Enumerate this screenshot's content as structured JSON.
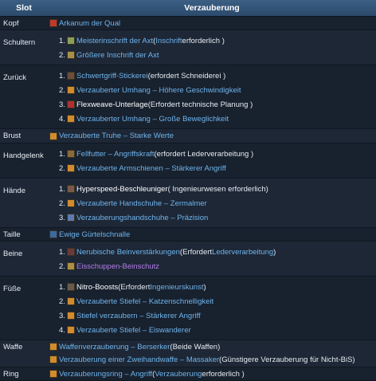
{
  "header": {
    "slot": "Slot",
    "enchant": "Verzauberung"
  },
  "rows": {
    "kopf": {
      "slot": "Kopf",
      "item": "Arkanum der Qual",
      "icon_color": "#c0392b"
    },
    "schultern": {
      "slot": "Schultern",
      "items": [
        {
          "num": "1.",
          "link": "Meisterinschrift der Axt",
          "pre": " (",
          "link2": "Inschrift",
          "post": " erforderlich )",
          "icon_color": "#8aa05a"
        },
        {
          "num": "2.",
          "link": "Größere Inschrift der Axt",
          "icon_color": "#a88f4a"
        }
      ]
    },
    "zurueck": {
      "slot": "Zurück",
      "items": [
        {
          "num": "1.",
          "link": "Schwertgriff-Stickerei",
          "post": " (erfordert Schneiderei )",
          "icon_color": "#6b4f3a"
        },
        {
          "num": "2.",
          "link": "Verzauberter Umhang – Höhere Geschwindigkeit",
          "icon_color": "#d28b2d"
        },
        {
          "num": "3.",
          "link": "Flexweave-Unterlage",
          "pre": " (Erfordert technische Planung )",
          "icon_color": "#b03030"
        },
        {
          "num": "4.",
          "link": "Verzauberter Umhang – Große Beweglichkeit",
          "icon_color": "#d28b2d"
        }
      ]
    },
    "brust": {
      "slot": "Brust",
      "item": "Verzauberte Truhe – Starke Werte",
      "icon_color": "#d28b2d"
    },
    "handgelenk": {
      "slot": "Handgelenk",
      "items": [
        {
          "num": "1.",
          "link": "Fellfutter – Angriffskraft",
          "post": " (erfordert Lederverarbeitung )",
          "icon_color": "#8a6a3a"
        },
        {
          "num": "2.",
          "link": "Verzauberte Armschienen – Stärkerer Angriff",
          "icon_color": "#d28b2d"
        }
      ]
    },
    "haende": {
      "slot": "Hände",
      "items": [
        {
          "num": "1.",
          "link": "Hyperspeed-Beschleuniger",
          "pre": " ( Ingenieurwesen erforderlich)",
          "icon_color": "#7a5a4a"
        },
        {
          "num": "2.",
          "link": "Verzauberte Handschuhe – Zermalmer",
          "icon_color": "#d28b2d"
        },
        {
          "num": "3.",
          "link": "Verzauberungshandschuhe – Präzision",
          "icon_color": "#5a7ab0"
        }
      ]
    },
    "taille": {
      "slot": "Taille",
      "item": "Ewige Gürtelschnalle",
      "icon_color": "#3a6aa0"
    },
    "beine": {
      "slot": "Beine",
      "items": [
        {
          "num": "1.",
          "link": "Nerubische Beinverstärkungen",
          "post": " (Erfordert ",
          "link2": "Lederverarbeitung",
          "post2": " )",
          "icon_color": "#6a3a3a"
        },
        {
          "num": "2.",
          "link": "Eisschuppen-Beinschutz",
          "icon_color": "#b09040"
        }
      ]
    },
    "fuesse": {
      "slot": "Füße",
      "items": [
        {
          "num": "1.",
          "link": "Nitro-Boosts",
          "post": " (Erfordert ",
          "link2": "Ingenieurskunst",
          "post2": " )",
          "icon_color": "#6a5a4a"
        },
        {
          "num": "2.",
          "link": "Verzauberte Stiefel – Katzenschnelligkeit",
          "icon_color": "#d28b2d"
        },
        {
          "num": "3.",
          "link": "Stiefel verzaubern – Stärkerer Angriff",
          "icon_color": "#d28b2d"
        },
        {
          "num": "4.",
          "link": "Verzauberte Stiefel – Eiswanderer",
          "icon_color": "#d28b2d"
        }
      ]
    },
    "waffe": {
      "slot": "Waffe",
      "lines": [
        {
          "link": "Waffenverzauberung – Berserker",
          "post": " (Beide Waffen)",
          "icon_color": "#d28b2d"
        },
        {
          "link": "Verzauberung einer Zweihandwaffe – Massaker",
          "post": " (Günstigere Verzauberung für Nicht-BiS)",
          "icon_color": "#d28b2d"
        }
      ]
    },
    "ring": {
      "slot": "Ring",
      "link": "Verzauberungsring – Angriff",
      "pre": " (",
      "link2": "Verzauberung",
      "post": " erforderlich )",
      "icon_color": "#d28b2d"
    }
  }
}
